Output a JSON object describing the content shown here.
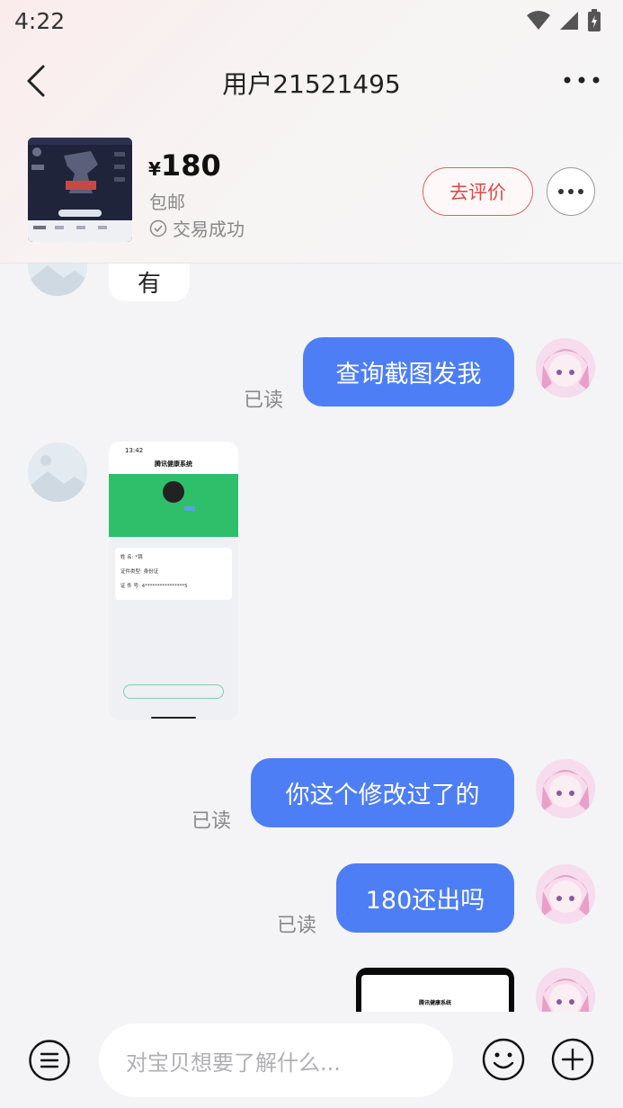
{
  "status_bar": {
    "time": "4:22"
  },
  "header": {
    "title": "用户21521495"
  },
  "product": {
    "currency": "¥",
    "price": "180",
    "shipping": "包邮",
    "deal_status": "交易成功",
    "review_label": "去评价"
  },
  "messages": [
    {
      "side": "left",
      "text": "有"
    },
    {
      "side": "right",
      "text": "查询截图发我",
      "status": "已读"
    },
    {
      "side": "left",
      "type": "image",
      "caption": "腾讯健康系统"
    },
    {
      "side": "right",
      "text": "你这个修改过了的",
      "status": "已读"
    },
    {
      "side": "right",
      "text": "180还出吗",
      "status": "已读"
    },
    {
      "side": "right",
      "type": "image",
      "caption": "腾讯健康系统"
    }
  ],
  "shot": {
    "time": "13:42",
    "title": "腾讯健康系统",
    "name_label": "姓  名:",
    "name_value": "*镜",
    "doc_type_label": "证件类型:",
    "doc_type_value": "身份证",
    "doc_no_label": "证 件 号:",
    "doc_no_value": "4****************5"
  },
  "input": {
    "placeholder": "对宝贝想要了解什么..."
  },
  "colors": {
    "accent": "#4d7ef5",
    "review": "#e04848",
    "health_green": "#2fbf6b"
  }
}
